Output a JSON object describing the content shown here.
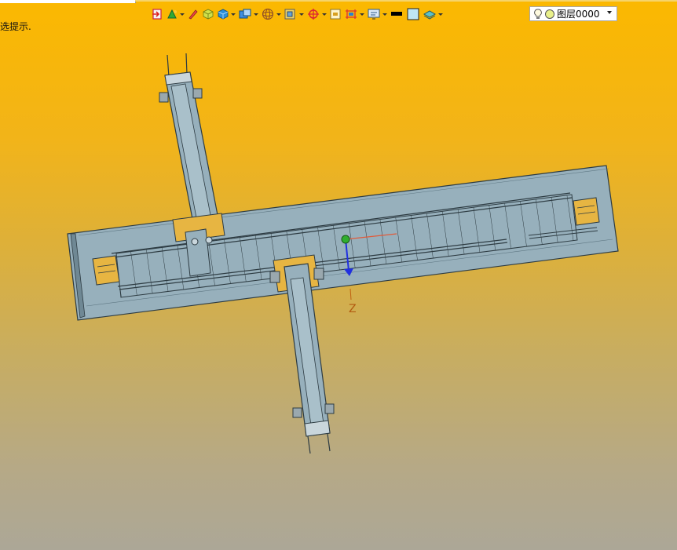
{
  "status": {
    "hint_text": "选提示."
  },
  "toolbar": {
    "buttons": [
      {
        "icon": "orient-view-icon"
      },
      {
        "icon": "render-style-icon"
      },
      {
        "icon": "pen-icon"
      },
      {
        "icon": "cube-shaded-icon"
      },
      {
        "icon": "cube-blue-icon"
      },
      {
        "icon": "view-cube-icon"
      },
      {
        "icon": "wireframe-sphere-icon"
      },
      {
        "icon": "box-frame-icon"
      },
      {
        "icon": "target-icon"
      },
      {
        "icon": "square-icon"
      },
      {
        "icon": "section-icon"
      },
      {
        "icon": "monitor-icon"
      },
      {
        "icon": "line-thickness-icon"
      },
      {
        "icon": "color-square-icon"
      },
      {
        "icon": "layer-stack-icon"
      }
    ],
    "layer": {
      "name": "图层0000"
    }
  },
  "viewport": {
    "axis_label": "Z",
    "colors": {
      "steel": "#97b0bc",
      "bracket": "#e7b542",
      "edge": "#2d3b42"
    }
  }
}
